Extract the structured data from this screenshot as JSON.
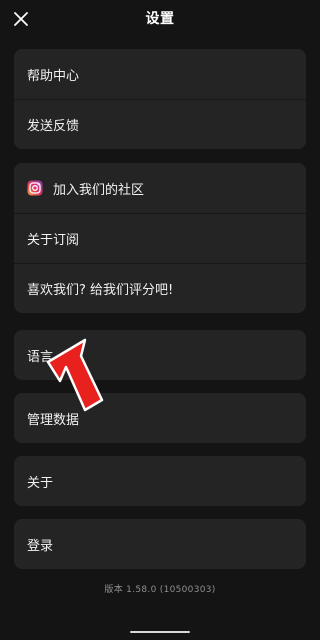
{
  "header": {
    "title": "设置",
    "close_icon": "close-icon"
  },
  "groups": {
    "support": {
      "help_center": "帮助中心",
      "feedback": "发送反馈"
    },
    "community": {
      "join_community": "加入我们的社区",
      "join_community_icon": "instagram-icon",
      "subscription": "关于订阅",
      "rate_us": "喜欢我们? 给我们评分吧!"
    },
    "language": {
      "label": "语言"
    },
    "data": {
      "label": "管理数据"
    },
    "about": {
      "label": "关于"
    },
    "account": {
      "label": "登录"
    }
  },
  "footer": {
    "version": "版本 1.58.0 (10500303)"
  },
  "annotation": {
    "arrow_color": "#e8211f",
    "arrow_icon": "red-arrow-pointer"
  },
  "colors": {
    "background": "#141414",
    "card": "#242424",
    "text": "#f2f2f2",
    "muted": "#8f8f8f"
  }
}
